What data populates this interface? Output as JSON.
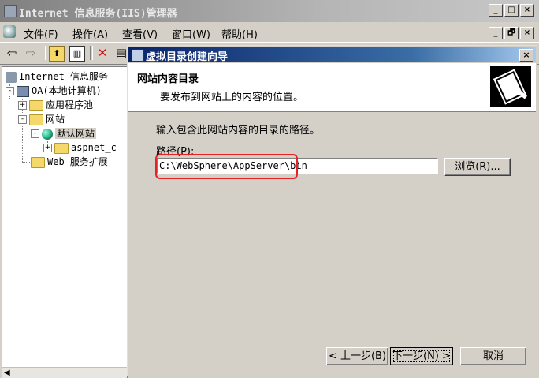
{
  "main_window": {
    "title": "Internet 信息服务(IIS)管理器",
    "caption_buttons": [
      "_",
      "□",
      "×"
    ],
    "doc_caption_buttons": [
      "_",
      "🗗",
      "×"
    ]
  },
  "menubar": {
    "items": [
      "文件(F)",
      "操作(A)",
      "查看(V)",
      "窗口(W)",
      "帮助(H)"
    ]
  },
  "toolbar": {
    "icons": [
      "back-arrow-icon",
      "forward-arrow-icon",
      "up-folder-icon",
      "show-tree-icon",
      "delete-icon",
      "properties-icon"
    ]
  },
  "tree": {
    "root": "Internet 信息服务",
    "computer": "OA(本地计算机)",
    "app_pools": "应用程序池",
    "websites": "网站",
    "default_site": "默认网站",
    "aspnet": "aspnet_c",
    "web_ext": "Web 服务扩展",
    "expander_plus": "+",
    "expander_minus": "-"
  },
  "wizard": {
    "title": "虚拟目录创建向导",
    "close": "×",
    "heading": "网站内容目录",
    "subheading": "要发布到网站上的内容的位置。",
    "instruction": "输入包含此网站内容的目录的路径。",
    "path_label": "路径(P):",
    "path_value": "C:\\WebSphere\\AppServer\\bin",
    "browse_button": "浏览(R)...",
    "back_button": "< 上一步(B)",
    "next_button": "下一步(N) >",
    "cancel_button": "取消"
  },
  "colors": {
    "dialog_title_start": "#0a246a",
    "dialog_title_end": "#a6caf0",
    "highlight_annotation": "#e52323",
    "window_face": "#d4d0c8"
  }
}
